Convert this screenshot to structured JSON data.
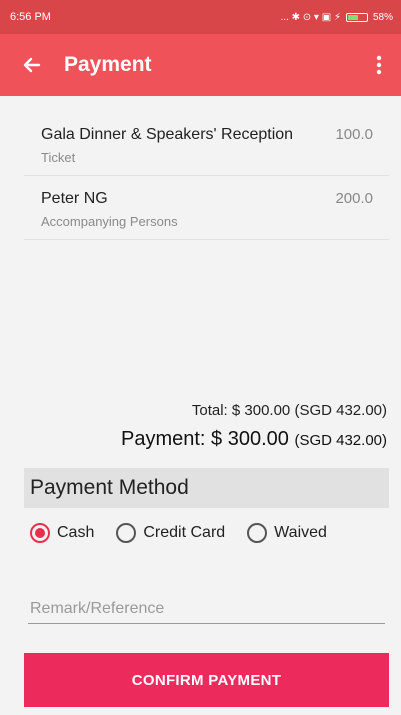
{
  "status_bar": {
    "time": "6:56 PM",
    "indicators": "... ✱ ⊙ ▾ ▣ ⚡",
    "battery": "58%",
    "battery_level": 0.58,
    "battery_color": "#7fe07a"
  },
  "app_bar": {
    "title": "Payment",
    "back_icon": "arrow-left-icon",
    "menu_icon": "more-vertical-icon",
    "color": "#f0525a"
  },
  "items": [
    {
      "name": "Gala Dinner & Speakers' Reception",
      "type": "Ticket",
      "price": "100.0"
    },
    {
      "name": "Peter NG",
      "type": "Accompanying Persons",
      "price": "200.0"
    }
  ],
  "summary": {
    "total_label": "Total: $ 300.00",
    "total_sgd": "(SGD 432.00)",
    "payment_label": "Payment: $ 300.00",
    "payment_sgd": "(SGD 432.00)"
  },
  "payment_method": {
    "heading": "Payment Method",
    "options": [
      "Cash",
      "Credit Card",
      "Waived"
    ],
    "selected": "Cash"
  },
  "remark": {
    "placeholder": "Remark/Reference",
    "value": ""
  },
  "confirm": {
    "label": "CONFIRM PAYMENT",
    "color": "#ec2a5c"
  }
}
